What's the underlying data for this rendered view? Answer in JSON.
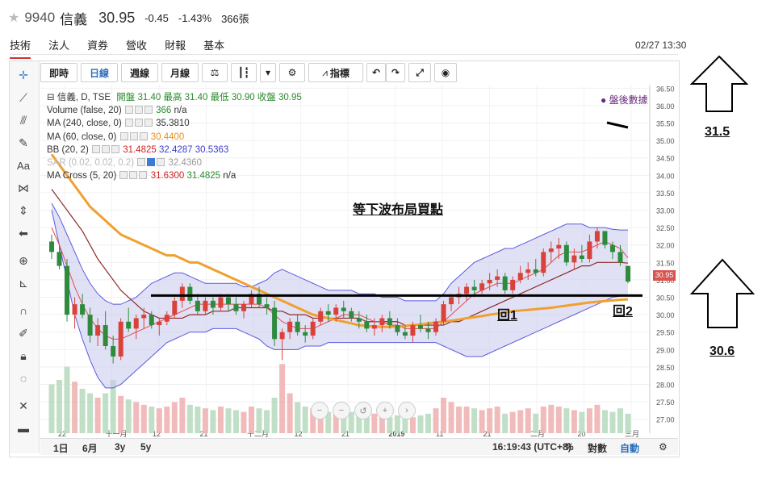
{
  "header": {
    "star_icon": "star-icon",
    "code": "9940",
    "name": "信義",
    "price": "30.95",
    "change": "-0.45",
    "change_pct": "-1.43%",
    "volume": "366張"
  },
  "tabs": [
    "技術",
    "法人",
    "資券",
    "營收",
    "財報",
    "基本"
  ],
  "datetime": "02/27 13:30",
  "toolbar": {
    "buttons": [
      "即時",
      "日線",
      "週線",
      "月線"
    ],
    "indicator_label": "指標",
    "active": "日線"
  },
  "legend": {
    "title": "信義, D, TSE",
    "ohlc": "開盤 31.40 最高 31.40 最低 30.90 收盤 30.95",
    "rows": [
      {
        "label": "Volume (false, 20)",
        "values": [
          "366",
          "n/a"
        ]
      },
      {
        "label": "MA (240, close, 0)",
        "values": [
          "35.3810"
        ]
      },
      {
        "label": "MA (60, close, 0)",
        "values": [
          "30.4400"
        ]
      },
      {
        "label": "BB (20, 2)",
        "values": [
          "31.4825",
          "32.4287",
          "30.5363"
        ]
      },
      {
        "label": "SAR (0.02, 0.02, 0.2)",
        "values": [
          "32.4360"
        ]
      },
      {
        "label": "MA Cross (5, 20)",
        "values": [
          "31.6300",
          "31.4825",
          "n/a"
        ]
      }
    ]
  },
  "after_hours": "● 盤後數據",
  "annotations": {
    "main": "等下波布局買點",
    "pullback1": "回1",
    "pullback2": "回2",
    "upper_level": "31.5",
    "lower_level": "30.6"
  },
  "bottom_bar": {
    "ranges": [
      "1日",
      "6月",
      "3y",
      "5y"
    ],
    "clock": "16:19:43 (UTC+8)",
    "pct": "%",
    "log": "對數",
    "auto": "自動"
  },
  "chart_data": {
    "type": "candlestick",
    "x_ticks": [
      "22",
      "十一月",
      "12",
      "21",
      "十二月",
      "12",
      "21",
      "2019",
      "11",
      "21",
      "二月",
      "20",
      "三月"
    ],
    "y_ticks": [
      "27.00",
      "27.50",
      "28.00",
      "28.50",
      "29.00",
      "29.50",
      "30.00",
      "30.50",
      "31.00",
      "31.50",
      "32.00",
      "32.50",
      "33.00",
      "33.50",
      "34.00",
      "34.50",
      "35.00",
      "35.50",
      "36.00",
      "36.50"
    ],
    "ylim": [
      26.6,
      36.6
    ],
    "last_price": "30.95",
    "candles": [
      [
        32.1,
        32.3,
        31.6,
        31.8
      ],
      [
        31.8,
        32.0,
        31.3,
        31.4
      ],
      [
        31.4,
        31.6,
        29.8,
        30.0
      ],
      [
        30.0,
        30.5,
        29.6,
        30.3
      ],
      [
        30.3,
        30.6,
        29.9,
        30.0
      ],
      [
        30.0,
        30.2,
        29.2,
        29.4
      ],
      [
        29.4,
        29.9,
        29.1,
        29.7
      ],
      [
        29.7,
        30.1,
        29.0,
        29.1
      ],
      [
        29.1,
        29.4,
        28.6,
        28.8
      ],
      [
        28.8,
        29.9,
        28.7,
        29.8
      ],
      [
        29.8,
        30.2,
        29.5,
        29.6
      ],
      [
        29.6,
        30.0,
        29.3,
        29.9
      ],
      [
        29.9,
        30.2,
        29.6,
        30.0
      ],
      [
        30.0,
        30.1,
        29.6,
        29.7
      ],
      [
        29.7,
        29.9,
        29.4,
        29.8
      ],
      [
        29.8,
        30.1,
        29.7,
        30.0
      ],
      [
        30.0,
        30.5,
        29.9,
        30.4
      ],
      [
        30.4,
        30.9,
        30.2,
        30.8
      ],
      [
        30.8,
        30.9,
        30.3,
        30.4
      ],
      [
        30.4,
        30.6,
        30.0,
        30.1
      ],
      [
        30.1,
        30.5,
        30.0,
        30.4
      ],
      [
        30.4,
        30.5,
        30.0,
        30.2
      ],
      [
        30.2,
        30.6,
        30.1,
        30.5
      ],
      [
        30.5,
        30.6,
        30.1,
        30.3
      ],
      [
        30.3,
        30.5,
        30.0,
        30.1
      ],
      [
        30.1,
        30.4,
        29.9,
        30.3
      ],
      [
        30.3,
        30.7,
        30.2,
        30.6
      ],
      [
        30.6,
        30.8,
        30.2,
        30.3
      ],
      [
        30.3,
        30.5,
        30.0,
        30.2
      ],
      [
        30.2,
        30.4,
        29.1,
        29.3
      ],
      [
        29.3,
        29.6,
        28.7,
        29.5
      ],
      [
        29.5,
        29.9,
        29.3,
        29.8
      ],
      [
        29.8,
        30.0,
        29.4,
        29.5
      ],
      [
        29.5,
        29.7,
        29.2,
        29.4
      ],
      [
        29.4,
        29.9,
        29.3,
        29.8
      ],
      [
        29.8,
        30.2,
        29.7,
        30.1
      ],
      [
        30.1,
        30.3,
        29.8,
        30.0
      ],
      [
        30.0,
        30.3,
        29.8,
        30.2
      ],
      [
        30.2,
        30.4,
        29.9,
        30.1
      ],
      [
        30.1,
        30.2,
        29.8,
        29.9
      ],
      [
        29.9,
        30.1,
        29.6,
        29.8
      ],
      [
        29.8,
        30.0,
        29.5,
        29.6
      ],
      [
        29.6,
        29.9,
        29.4,
        29.7
      ],
      [
        29.7,
        30.0,
        29.5,
        29.9
      ],
      [
        29.9,
        30.1,
        29.6,
        29.7
      ],
      [
        29.7,
        29.9,
        29.4,
        29.5
      ],
      [
        29.5,
        29.7,
        29.3,
        29.4
      ],
      [
        29.4,
        29.8,
        29.2,
        29.7
      ],
      [
        29.7,
        30.0,
        29.5,
        29.6
      ],
      [
        29.6,
        29.8,
        29.3,
        29.5
      ],
      [
        29.5,
        29.9,
        29.4,
        29.8
      ],
      [
        29.8,
        30.4,
        29.7,
        30.3
      ],
      [
        30.3,
        30.6,
        30.1,
        30.5
      ],
      [
        30.5,
        30.8,
        30.3,
        30.6
      ],
      [
        30.6,
        30.9,
        30.4,
        30.8
      ],
      [
        30.8,
        31.0,
        30.5,
        30.7
      ],
      [
        30.7,
        31.0,
        30.6,
        30.9
      ],
      [
        30.9,
        31.2,
        30.7,
        31.0
      ],
      [
        31.0,
        31.3,
        30.8,
        31.1
      ],
      [
        31.1,
        31.2,
        30.6,
        30.7
      ],
      [
        30.7,
        31.1,
        30.6,
        31.0
      ],
      [
        31.0,
        31.4,
        30.9,
        31.2
      ],
      [
        31.2,
        31.5,
        31.0,
        31.3
      ],
      [
        31.3,
        31.6,
        31.1,
        31.2
      ],
      [
        31.2,
        31.9,
        31.1,
        31.8
      ],
      [
        31.8,
        32.1,
        31.5,
        31.9
      ],
      [
        31.9,
        32.2,
        31.6,
        32.0
      ],
      [
        32.0,
        32.1,
        31.4,
        31.5
      ],
      [
        31.5,
        31.9,
        31.3,
        31.7
      ],
      [
        31.7,
        32.0,
        31.5,
        31.6
      ],
      [
        31.6,
        32.3,
        31.5,
        32.1
      ],
      [
        32.1,
        32.5,
        31.9,
        32.4
      ],
      [
        32.4,
        32.4,
        31.9,
        32.0
      ],
      [
        32.0,
        32.1,
        31.6,
        31.8
      ],
      [
        31.8,
        32.0,
        31.4,
        31.5
      ],
      [
        31.4,
        31.4,
        30.9,
        30.95
      ]
    ],
    "volume": [
      55,
      60,
      75,
      58,
      50,
      45,
      40,
      45,
      60,
      42,
      38,
      35,
      32,
      30,
      28,
      30,
      35,
      40,
      32,
      30,
      28,
      26,
      30,
      28,
      26,
      24,
      30,
      28,
      26,
      40,
      78,
      45,
      35,
      30,
      28,
      26,
      24,
      22,
      26,
      24,
      22,
      20,
      22,
      20,
      18,
      20,
      22,
      18,
      20,
      22,
      28,
      40,
      35,
      30,
      30,
      28,
      26,
      28,
      30,
      22,
      24,
      26,
      28,
      22,
      30,
      32,
      30,
      28,
      26,
      24,
      28,
      32,
      26,
      24,
      28,
      22
    ],
    "volume_ylim": [
      0,
      100
    ],
    "ma_cross_fast": [
      32.5,
      32.0,
      31.4,
      30.8,
      30.3,
      29.9,
      29.6,
      29.4,
      29.3,
      29.3,
      29.4,
      29.5,
      29.6,
      29.7,
      29.8,
      29.9,
      30.0,
      30.1,
      30.2,
      30.3,
      30.3,
      30.3,
      30.3,
      30.3,
      30.3,
      30.3,
      30.3,
      30.3,
      30.2,
      30.0,
      29.8,
      29.7,
      29.6,
      29.6,
      29.6,
      29.7,
      29.8,
      29.9,
      30.0,
      30.0,
      30.0,
      29.9,
      29.8,
      29.8,
      29.7,
      29.7,
      29.6,
      29.6,
      29.6,
      29.6,
      29.6,
      29.8,
      30.0,
      30.2,
      30.4,
      30.6,
      30.7,
      30.8,
      30.9,
      30.9,
      30.9,
      31.0,
      31.1,
      31.2,
      31.3,
      31.5,
      31.7,
      31.8,
      31.8,
      31.8,
      31.9,
      32.0,
      32.1,
      32.0,
      31.9,
      31.63
    ],
    "ma_cross_slow": [
      33.6,
      33.3,
      33.0,
      32.7,
      32.4,
      32.0,
      31.6,
      31.3,
      31.0,
      30.7,
      30.5,
      30.3,
      30.1,
      30.0,
      29.9,
      29.9,
      29.9,
      29.9,
      30.0,
      30.0,
      30.0,
      30.1,
      30.1,
      30.1,
      30.2,
      30.2,
      30.2,
      30.2,
      30.2,
      30.1,
      30.1,
      30.0,
      30.0,
      30.0,
      29.9,
      29.9,
      29.9,
      29.9,
      29.9,
      29.9,
      29.9,
      29.8,
      29.8,
      29.8,
      29.8,
      29.8,
      29.7,
      29.7,
      29.7,
      29.7,
      29.7,
      29.7,
      29.8,
      29.8,
      29.9,
      30.0,
      30.1,
      30.2,
      30.3,
      30.4,
      30.5,
      30.6,
      30.7,
      30.8,
      30.9,
      31.0,
      31.1,
      31.2,
      31.3,
      31.4,
      31.4,
      31.5,
      31.5,
      31.5,
      31.5,
      31.48
    ],
    "ma60": [
      34.6,
      34.3,
      34.0,
      33.7,
      33.4,
      33.1,
      32.9,
      32.7,
      32.5,
      32.3,
      32.2,
      32.1,
      32.0,
      31.9,
      31.8,
      31.7,
      31.7,
      31.6,
      31.5,
      31.5,
      31.4,
      31.3,
      31.2,
      31.1,
      31.0,
      30.9,
      30.8,
      30.7,
      30.6,
      30.5,
      30.4,
      30.3,
      30.2,
      30.1,
      30.0,
      29.95,
      29.9,
      29.85,
      29.8,
      29.75,
      29.7,
      29.68,
      29.66,
      29.65,
      29.65,
      29.66,
      29.68,
      29.7,
      29.72,
      29.75,
      29.78,
      29.8,
      29.83,
      29.86,
      29.9,
      29.93,
      29.96,
      30.0,
      30.03,
      30.06,
      30.1,
      30.12,
      30.14,
      30.16,
      30.18,
      30.2,
      30.23,
      30.26,
      30.29,
      30.32,
      30.35,
      30.37,
      30.39,
      30.41,
      30.43,
      30.44
    ],
    "bb_upper": [
      33.2,
      32.8,
      32.3,
      31.8,
      31.3,
      30.9,
      30.6,
      30.4,
      30.3,
      30.3,
      30.4,
      30.5,
      30.7,
      30.9,
      31.0,
      31.1,
      31.2,
      31.2,
      31.1,
      31.0,
      30.9,
      30.9,
      30.9,
      30.9,
      30.9,
      30.8,
      30.8,
      30.9,
      31.0,
      31.2,
      31.3,
      31.2,
      31.1,
      31.0,
      30.9,
      30.8,
      30.7,
      30.7,
      30.7,
      30.7,
      30.6,
      30.6,
      30.6,
      30.5,
      30.5,
      30.5,
      30.4,
      30.4,
      30.4,
      30.4,
      30.4,
      30.6,
      30.9,
      31.1,
      31.3,
      31.5,
      31.6,
      31.7,
      31.8,
      31.9,
      31.9,
      32.0,
      32.1,
      32.2,
      32.3,
      32.4,
      32.5,
      32.6,
      32.6,
      32.6,
      32.5,
      32.5,
      32.5,
      32.45,
      32.43,
      32.43
    ],
    "bb_lower": [
      33.0,
      32.0,
      31.0,
      30.0,
      29.3,
      28.7,
      28.2,
      27.9,
      27.9,
      28.0,
      28.2,
      28.4,
      28.6,
      28.8,
      29.0,
      29.2,
      29.3,
      29.4,
      29.5,
      29.5,
      29.5,
      29.6,
      29.6,
      29.6,
      29.6,
      29.5,
      29.4,
      29.3,
      29.1,
      29.0,
      29.0,
      29.0,
      29.0,
      29.1,
      29.1,
      29.1,
      29.2,
      29.2,
      29.2,
      29.2,
      29.2,
      29.2,
      29.2,
      29.2,
      29.2,
      29.2,
      29.2,
      29.2,
      29.2,
      29.2,
      29.2,
      29.1,
      29.0,
      28.9,
      28.8,
      28.8,
      28.8,
      28.9,
      29.0,
      29.1,
      29.2,
      29.3,
      29.4,
      29.5,
      29.6,
      29.7,
      29.8,
      29.9,
      30.0,
      30.1,
      30.2,
      30.3,
      30.4,
      30.5,
      30.53,
      30.54
    ],
    "support_line": 30.55
  }
}
